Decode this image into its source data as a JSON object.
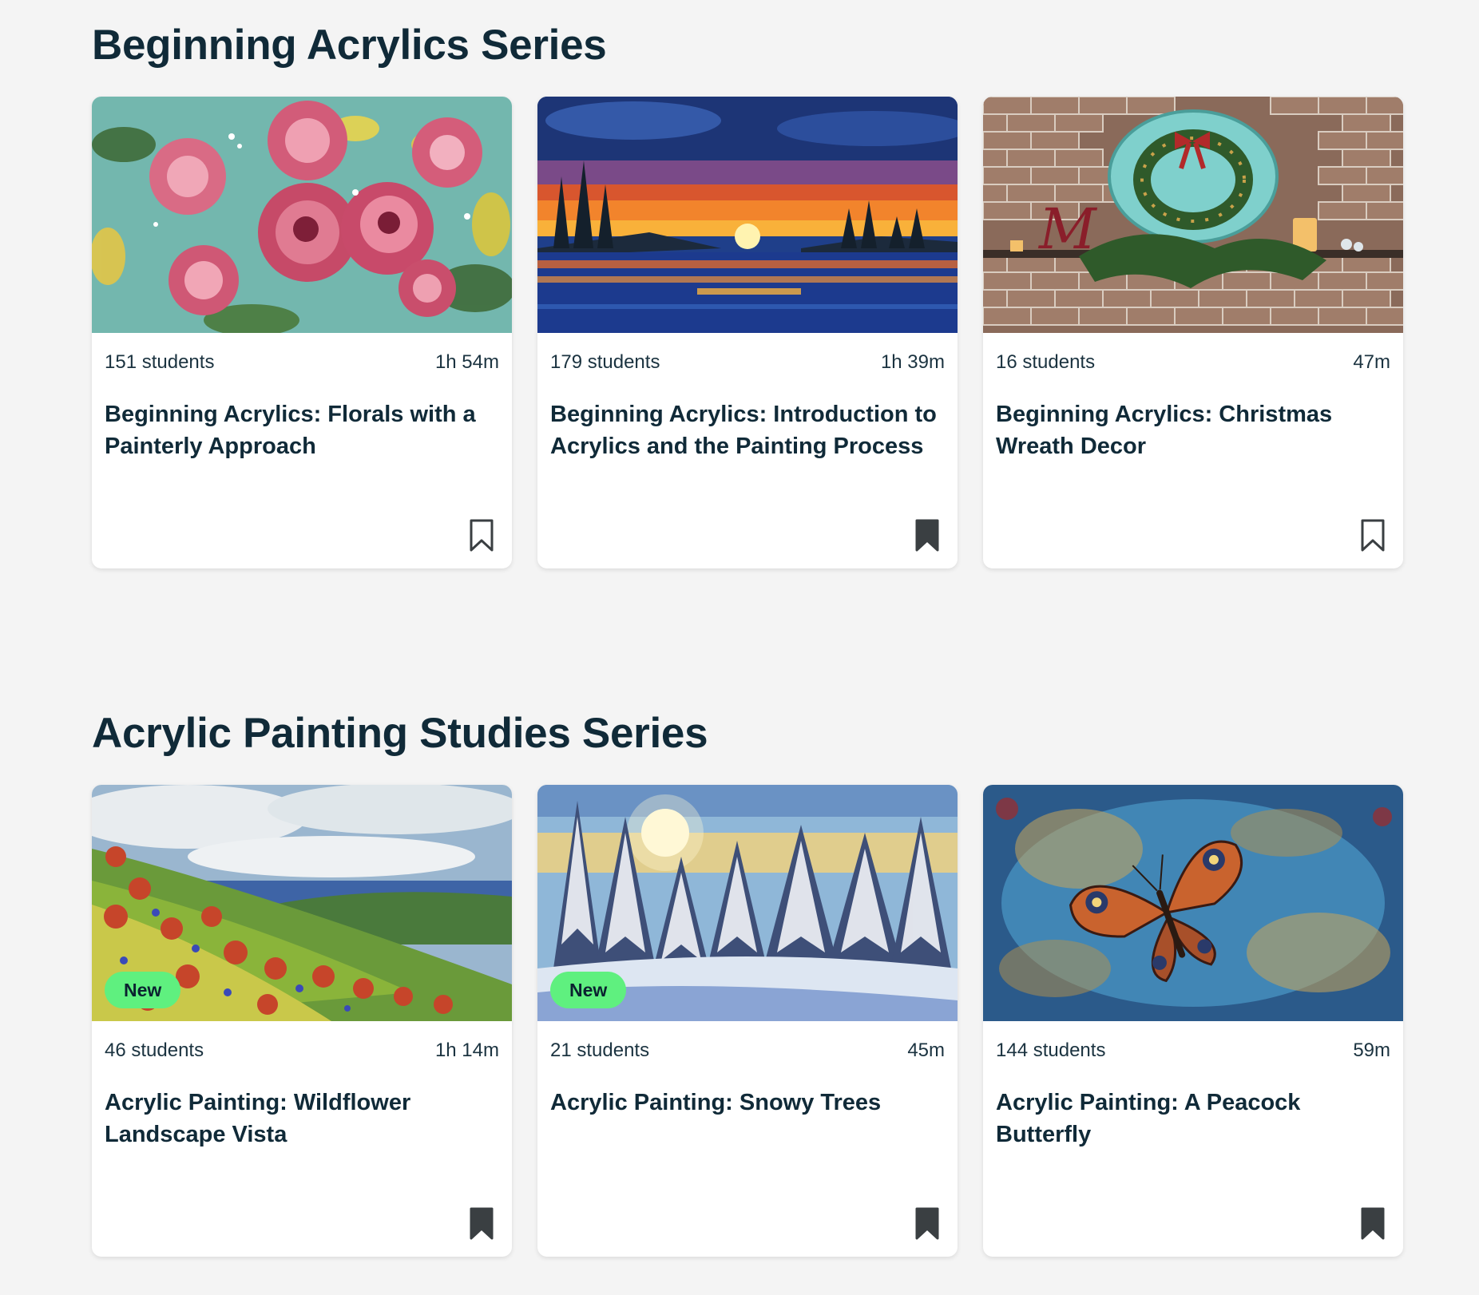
{
  "sections": [
    {
      "title": "Beginning Acrylics Series",
      "cards": [
        {
          "students": "151 students",
          "duration": "1h 54m",
          "title": "Beginning Acrylics: Florals with a Painterly Approach",
          "badge": "",
          "saved": false,
          "image": "roses-painting"
        },
        {
          "students": "179 students",
          "duration": "1h 39m",
          "title": "Beginning Acrylics: Introduction to Acrylics and the Painting Process",
          "badge": "",
          "saved": true,
          "image": "sunset-lake-painting"
        },
        {
          "students": "16 students",
          "duration": "47m",
          "title": "Beginning Acrylics: Christmas Wreath Decor",
          "badge": "",
          "saved": false,
          "image": "wreath-on-brick-wall"
        }
      ]
    },
    {
      "title": "Acrylic Painting Studies Series",
      "cards": [
        {
          "students": "46 students",
          "duration": "1h 14m",
          "title": "Acrylic Painting: Wildflower Landscape Vista",
          "badge": "New",
          "saved": true,
          "image": "wildflower-landscape-painting"
        },
        {
          "students": "21 students",
          "duration": "45m",
          "title": "Acrylic Painting: Snowy Trees",
          "badge": "New",
          "saved": true,
          "image": "snowy-trees-painting"
        },
        {
          "students": "144 students",
          "duration": "59m",
          "title": "Acrylic Painting: A Peacock Butterfly",
          "badge": "",
          "saved": true,
          "image": "peacock-butterfly-painting"
        }
      ]
    }
  ],
  "colors": {
    "background": "#f4f4f4",
    "heading": "#102a38",
    "badge": "#5ff07f",
    "bookmark": "#3a3f42"
  }
}
